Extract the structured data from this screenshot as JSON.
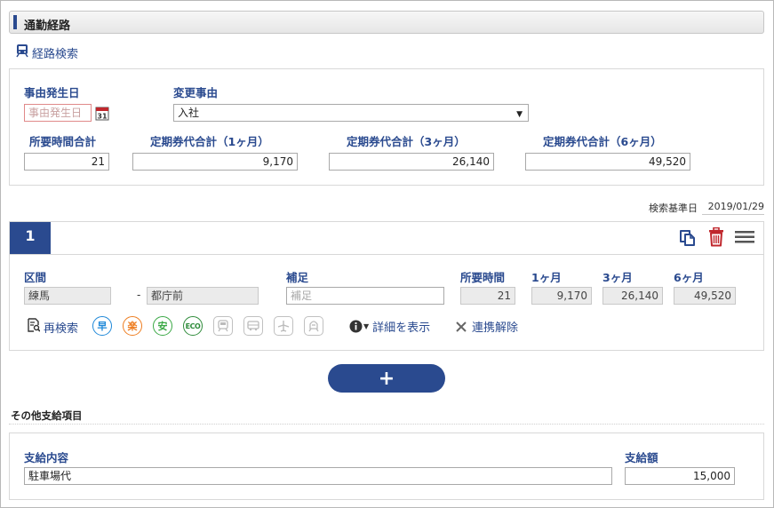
{
  "header": {
    "title": "通勤経路"
  },
  "route_search": {
    "label": "経路検索"
  },
  "event": {
    "date_label": "事由発生日",
    "date_placeholder": "事由発生日",
    "reason_label": "変更事由",
    "reason_value": "入社"
  },
  "totals": {
    "time_label": "所要時間合計",
    "time_value": "21",
    "pass1_label": "定期券代合計（1ヶ月）",
    "pass1_value": "9,170",
    "pass3_label": "定期券代合計（3ヶ月）",
    "pass3_value": "26,140",
    "pass6_label": "定期券代合計（6ヶ月）",
    "pass6_value": "49,520"
  },
  "search_base": {
    "label": "検索基準日",
    "value": "2019/01/29"
  },
  "route": {
    "number": "1",
    "section_label": "区間",
    "from": "練馬",
    "separator": "-",
    "to": "都庁前",
    "note_label": "補足",
    "note_placeholder": "補足",
    "time_label": "所要時間",
    "time_value": "21",
    "m1_label": "1ヶ月",
    "m1_value": "9,170",
    "m3_label": "3ヶ月",
    "m3_value": "26,140",
    "m6_label": "6ヶ月",
    "m6_value": "49,520",
    "research_label": "再検索",
    "badges": {
      "fast": "早",
      "easy": "楽",
      "cheap": "安",
      "eco": "ECO"
    },
    "detail_label": "詳細を表示",
    "unlink_label": "連携解除"
  },
  "add_button": {
    "label": "+"
  },
  "other": {
    "section_title": "その他支給項目",
    "content_label": "支給内容",
    "content_value": "駐車場代",
    "amount_label": "支給額",
    "amount_value": "15,000"
  },
  "colors": {
    "accent": "#2a4a8f",
    "delete": "#c0272d"
  },
  "icons": [
    "train-icon",
    "calendar-icon",
    "copy-icon",
    "trash-icon",
    "menu-icon",
    "document-search-icon",
    "info-icon",
    "close-icon",
    "plus-icon"
  ]
}
